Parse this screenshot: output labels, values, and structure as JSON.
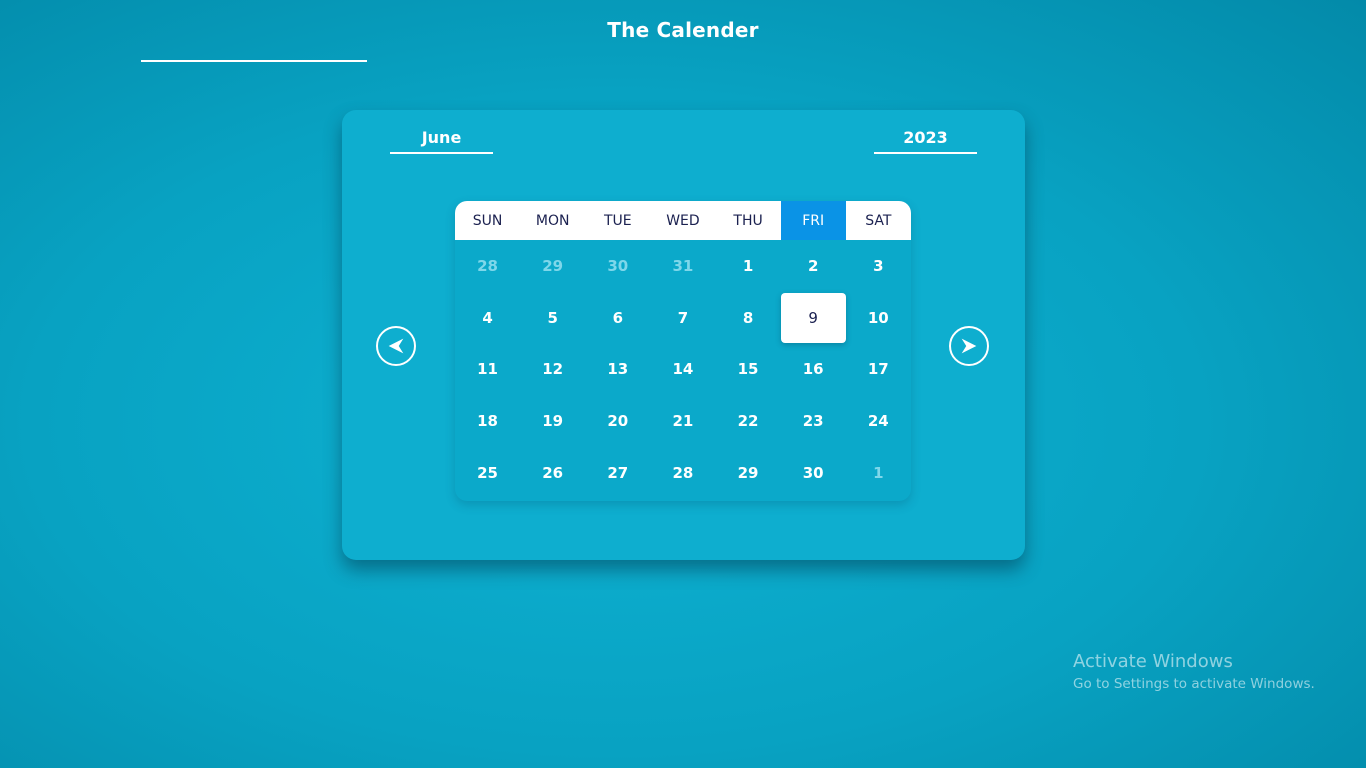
{
  "header": {
    "title": "The Calender"
  },
  "calendar": {
    "month": "June",
    "year": "2023",
    "weekdays": [
      "SUN",
      "MON",
      "TUE",
      "WED",
      "THU",
      "FRI",
      "SAT"
    ],
    "today_weekday_index": 5,
    "selected_day": "9",
    "weeks": [
      [
        {
          "d": "28",
          "muted": true
        },
        {
          "d": "29",
          "muted": true
        },
        {
          "d": "30",
          "muted": true
        },
        {
          "d": "31",
          "muted": true
        },
        {
          "d": "1"
        },
        {
          "d": "2"
        },
        {
          "d": "3"
        }
      ],
      [
        {
          "d": "4"
        },
        {
          "d": "5"
        },
        {
          "d": "6"
        },
        {
          "d": "7"
        },
        {
          "d": "8"
        },
        {
          "d": "9",
          "selected": true
        },
        {
          "d": "10"
        }
      ],
      [
        {
          "d": "11"
        },
        {
          "d": "12"
        },
        {
          "d": "13"
        },
        {
          "d": "14"
        },
        {
          "d": "15"
        },
        {
          "d": "16"
        },
        {
          "d": "17"
        }
      ],
      [
        {
          "d": "18"
        },
        {
          "d": "19"
        },
        {
          "d": "20"
        },
        {
          "d": "21"
        },
        {
          "d": "22"
        },
        {
          "d": "23"
        },
        {
          "d": "24"
        }
      ],
      [
        {
          "d": "25"
        },
        {
          "d": "26"
        },
        {
          "d": "27"
        },
        {
          "d": "28"
        },
        {
          "d": "29"
        },
        {
          "d": "30"
        },
        {
          "d": "1",
          "muted": true
        }
      ]
    ],
    "prev_icon": "arrow-left-icon",
    "next_icon": "arrow-right-icon"
  },
  "watermark": {
    "title": "Activate Windows",
    "subtitle": "Go to Settings to activate Windows."
  },
  "colors": {
    "background": "#0ba9ca",
    "header_row": "#ffffff",
    "today_header": "#0a93e6",
    "text_dark": "#1b2150",
    "muted_day": "#7fd7ea"
  }
}
